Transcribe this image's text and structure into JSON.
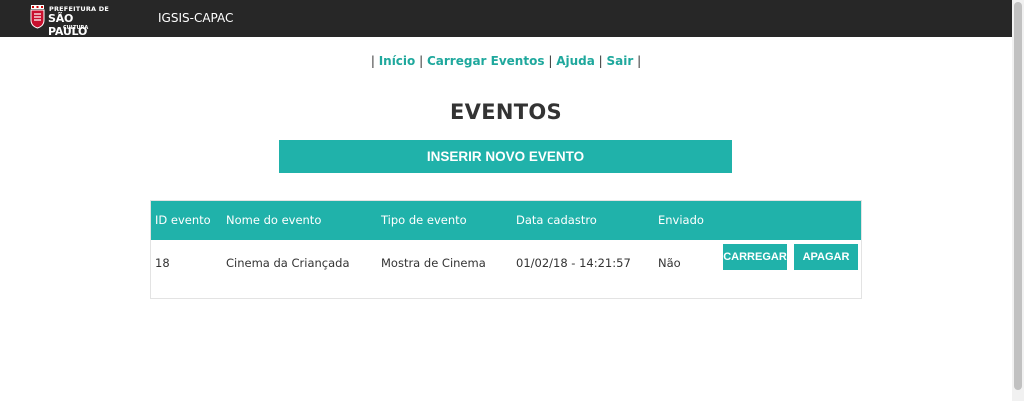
{
  "header": {
    "logo": {
      "line1": "PREFEITURA DE",
      "line2": "SÃO PAULO",
      "line3": "CULTURA"
    },
    "app_title": "IGSIS-CAPAC"
  },
  "nav": {
    "sep": "|",
    "items": [
      {
        "label": "Início"
      },
      {
        "label": "Carregar Eventos"
      },
      {
        "label": "Ajuda"
      },
      {
        "label": "Sair"
      }
    ]
  },
  "page_title": "EVENTOS",
  "new_event_button": "INSERIR NOVO EVENTO",
  "table": {
    "columns": [
      "ID evento",
      "Nome do evento",
      "Tipo de evento",
      "Data cadastro",
      "Enviado"
    ],
    "rows": [
      {
        "id": "18",
        "name": "Cinema da Criançada",
        "type": "Mostra de Cinema",
        "date": "01/02/18 - 14:21:57",
        "sent": "Não",
        "load_label": "CARREGAR",
        "delete_label": "APAGAR"
      }
    ]
  },
  "colors": {
    "topbar": "#272727",
    "accent": "#20b2aa",
    "link": "#1fa89d"
  }
}
